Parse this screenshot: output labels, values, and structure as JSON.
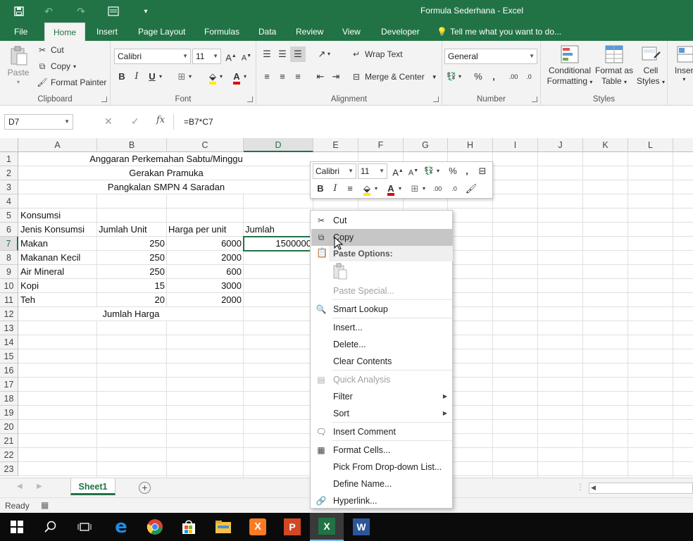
{
  "window": {
    "title": "Formula Sederhana - Excel"
  },
  "ribbon_tabs": [
    "File",
    "Home",
    "Insert",
    "Page Layout",
    "Formulas",
    "Data",
    "Review",
    "View",
    "Developer"
  ],
  "tell_me": "Tell me what you want to do...",
  "clipboard": {
    "paste": "Paste",
    "cut": "Cut",
    "copy": "Copy",
    "format_painter": "Format Painter",
    "label": "Clipboard"
  },
  "font": {
    "name": "Calibri",
    "size": "11",
    "label": "Font"
  },
  "alignment": {
    "wrap": "Wrap Text",
    "merge": "Merge & Center",
    "label": "Alignment"
  },
  "number": {
    "format": "General",
    "label": "Number"
  },
  "styles": {
    "conditional_1": "Conditional",
    "conditional_2": "Formatting",
    "format_table_1": "Format as",
    "format_table_2": "Table",
    "cell_styles_1": "Cell",
    "cell_styles_2": "Styles",
    "label": "Styles"
  },
  "cells_group": {
    "insert": "Inser"
  },
  "formula_bar": {
    "name_box": "D7",
    "fx": "fx",
    "formula": "=B7*C7"
  },
  "columns": [
    "A",
    "B",
    "C",
    "D",
    "E",
    "F",
    "G",
    "H",
    "I",
    "J",
    "K",
    "L"
  ],
  "rows": [
    "1",
    "2",
    "3",
    "4",
    "5",
    "6",
    "7",
    "8",
    "9",
    "10",
    "11",
    "12",
    "13",
    "14",
    "15",
    "16",
    "17",
    "18",
    "19",
    "20",
    "21",
    "22",
    "23"
  ],
  "cells": {
    "title1": "Anggaran Perkemahan Sabtu/Minggu",
    "title2": "Gerakan Pramuka",
    "title3": "Pangkalan SMPN 4 Saradan",
    "a5": "Konsumsi",
    "a6": "Jenis Konsumsi",
    "b6": "Jumlah Unit",
    "c6": "Harga per unit",
    "d6": "Jumlah",
    "a7": "Makan",
    "b7": "250",
    "c7": "6000",
    "d7": "1500000",
    "a8": "Makanan Kecil",
    "b8": "250",
    "c8": "2000",
    "a9": "Air Mineral",
    "b9": "250",
    "c9": "600",
    "a10": "Kopi",
    "b10": "15",
    "c10": "3000",
    "a11": "Teh",
    "b11": "20",
    "c11": "2000",
    "b12": "Jumlah Harga"
  },
  "mini_toolbar": {
    "font": "Calibri",
    "size": "11"
  },
  "context_menu": {
    "cut": "Cut",
    "copy": "Copy",
    "paste_options": "Paste Options:",
    "paste_special": "Paste Special...",
    "smart_lookup": "Smart Lookup",
    "insert": "Insert...",
    "delete": "Delete...",
    "clear_contents": "Clear Contents",
    "quick_analysis": "Quick Analysis",
    "filter": "Filter",
    "sort": "Sort",
    "insert_comment": "Insert Comment",
    "format_cells": "Format Cells...",
    "pick_list": "Pick From Drop-down List...",
    "define_name": "Define Name...",
    "hyperlink": "Hyperlink..."
  },
  "sheet": {
    "tab": "Sheet1"
  },
  "status": {
    "text": "Ready"
  },
  "colors": {
    "excel_green": "#217346",
    "menu_highlight": "#c6c6c6"
  },
  "icons": [
    "save-icon",
    "undo-icon",
    "redo-icon",
    "form-icon",
    "customize-icon",
    "lightbulb-icon",
    "cut-icon",
    "copy-icon",
    "paste-icon",
    "format-painter-icon",
    "bold-icon",
    "italic-icon",
    "underline-icon",
    "border-icon",
    "fill-color-icon",
    "font-color-icon",
    "wrap-text-icon",
    "merge-icon",
    "percent-icon",
    "comma-icon",
    "smart-lookup-icon",
    "comment-icon",
    "format-cells-icon",
    "hyperlink-icon",
    "windows-start-icon",
    "search-icon",
    "task-view-icon",
    "edge-icon",
    "chrome-icon",
    "store-icon",
    "explorer-icon",
    "xampp-icon",
    "powerpoint-icon",
    "excel-icon",
    "word-icon"
  ]
}
